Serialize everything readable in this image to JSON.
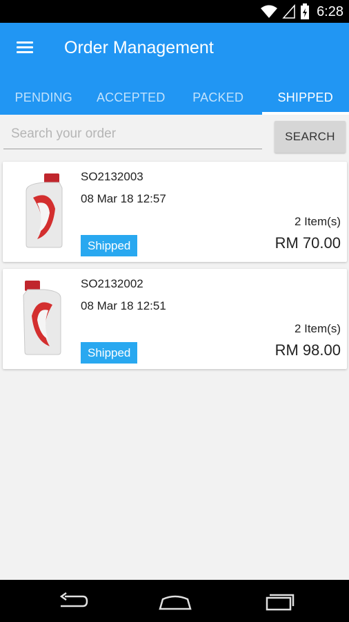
{
  "status_bar": {
    "time": "6:28"
  },
  "app_bar": {
    "title": "Order Management"
  },
  "tabs": [
    {
      "label": "PENDING"
    },
    {
      "label": "ACCEPTED"
    },
    {
      "label": "PACKED"
    },
    {
      "label": "SHIPPED",
      "active": true
    }
  ],
  "search": {
    "placeholder": "Search your order",
    "value": "",
    "button_label": "SEARCH"
  },
  "orders": [
    {
      "id": "SO2132003",
      "date": "08 Mar 18 12:57",
      "items": "2 Item(s)",
      "status": "Shipped",
      "price": "RM 70.00"
    },
    {
      "id": "SO2132002",
      "date": "08 Mar 18 12:51",
      "items": "2 Item(s)",
      "status": "Shipped",
      "price": "RM 98.00"
    }
  ],
  "colors": {
    "primary": "#2196f3",
    "badge": "#29a8f0",
    "background": "#f2f2f2"
  },
  "icons": [
    "wifi-icon",
    "signal-icon",
    "battery-icon",
    "menu-icon",
    "oil-bottle-icon",
    "back-icon",
    "home-icon",
    "recents-icon"
  ]
}
